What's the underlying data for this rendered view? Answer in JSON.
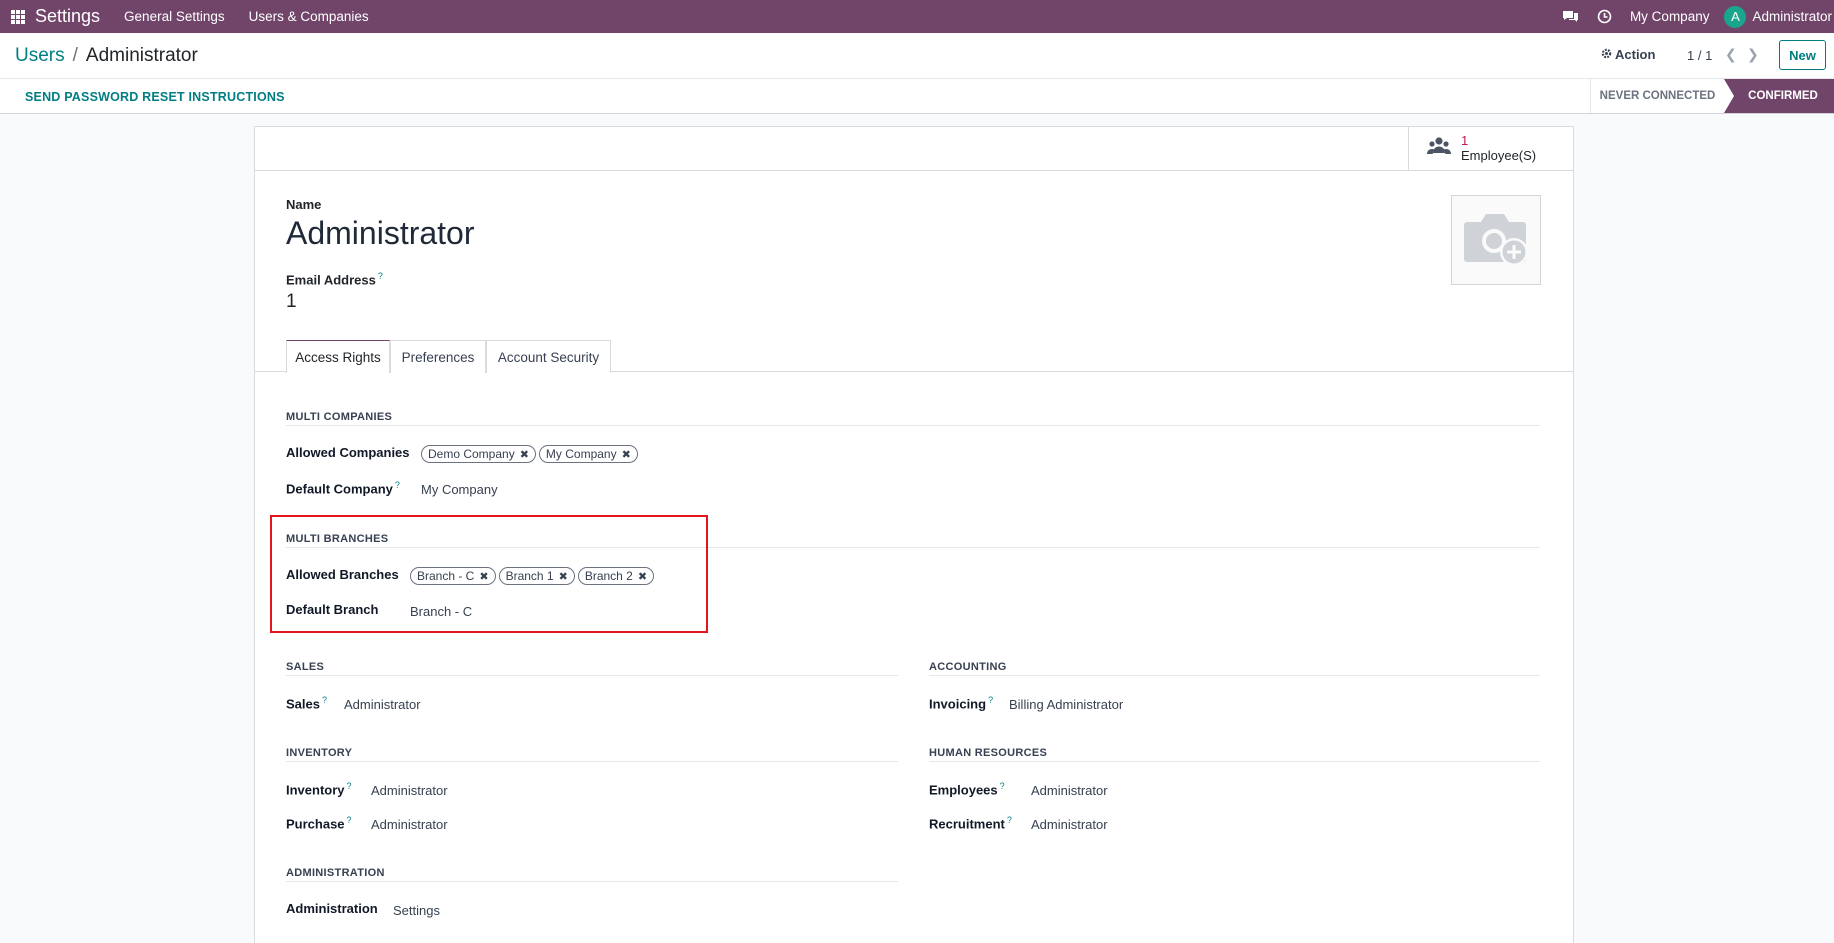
{
  "topbar": {
    "app_name": "Settings",
    "menu": [
      "General Settings",
      "Users & Companies"
    ],
    "company": "My Company",
    "avatar_letter": "A",
    "username": "Administrator"
  },
  "control": {
    "breadcrumb_parent": "Users",
    "breadcrumb_sep": "/",
    "breadcrumb_current": "Administrator",
    "action_label": "Action",
    "pager": "1 / 1",
    "new_label": "New"
  },
  "statusbar": {
    "reset_label": "SEND PASSWORD RESET INSTRUCTIONS",
    "stages": [
      "NEVER CONNECTED",
      "CONFIRMED"
    ],
    "active_stage": "CONFIRMED"
  },
  "smart_button": {
    "count": "1",
    "label": "Employee(S)"
  },
  "form": {
    "name_label": "Name",
    "name_value": "Administrator",
    "email_label": "Email Address",
    "email_help": "?",
    "email_value": "1"
  },
  "tabs": [
    "Access Rights",
    "Preferences",
    "Account Security"
  ],
  "multi_companies": {
    "title": "MULTI COMPANIES",
    "allowed_label": "Allowed Companies",
    "allowed_tags": [
      "Demo Company",
      "My Company"
    ],
    "default_label": "Default Company",
    "default_value": "My Company"
  },
  "multi_branches": {
    "title": "MULTI BRANCHES",
    "allowed_label": "Allowed Branches",
    "allowed_tags": [
      "Branch - C",
      "Branch 1",
      "Branch 2"
    ],
    "default_label": "Default Branch",
    "default_value": "Branch - C"
  },
  "sales": {
    "title": "SALES",
    "label": "Sales",
    "value": "Administrator"
  },
  "accounting": {
    "title": "ACCOUNTING",
    "label": "Invoicing",
    "value": "Billing Administrator"
  },
  "inventory": {
    "title": "INVENTORY",
    "inventory_label": "Inventory",
    "inventory_value": "Administrator",
    "purchase_label": "Purchase",
    "purchase_value": "Administrator"
  },
  "human_resources": {
    "title": "HUMAN RESOURCES",
    "employees_label": "Employees",
    "employees_value": "Administrator",
    "recruitment_label": "Recruitment",
    "recruitment_value": "Administrator"
  },
  "administration": {
    "title": "ADMINISTRATION",
    "label": "Administration",
    "value": "Settings"
  },
  "colors": {
    "brand": "#71456a",
    "accent": "#017e84",
    "highlight": "#e5161b"
  }
}
